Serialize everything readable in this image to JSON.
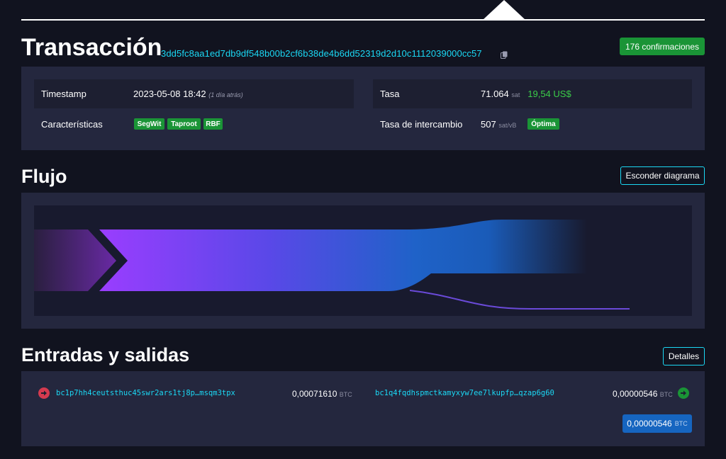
{
  "header": {
    "title": "Transacción",
    "txid": "3dd5fc8aa1ed7db9df548b00b2cf6b38de4b6dd52319d2d10c1112039000cc57",
    "confirmations": "176 confirmaciones"
  },
  "details": {
    "timestamp_label": "Timestamp",
    "timestamp_value": "2023-05-08 18:42",
    "timestamp_ago": "(1 día atrás)",
    "features_label": "Características",
    "features": [
      "SegWit",
      "Taproot",
      "RBF"
    ],
    "fee_label": "Tasa",
    "fee_value": "71.064",
    "fee_unit": "sat",
    "fee_usd": "19,54 US$",
    "fee_rate_label": "Tasa de intercambio",
    "fee_rate_value": "507",
    "fee_rate_unit": "sat/vB",
    "fee_rate_badge": "Óptima"
  },
  "flow": {
    "title": "Flujo",
    "toggle_label": "Esconder diagrama"
  },
  "io": {
    "title": "Entradas y salidas",
    "details_button": "Detalles",
    "input": {
      "address": "bc1p7hh4ceutsthuc45swr2ars1tj8p…msqm3tpx",
      "amount": "0,00071610",
      "unit": "BTC"
    },
    "output": {
      "address": "bc1q4fqdhspmctkamyxyw7ee7lkupfp…qzap6g60",
      "amount": "0,00000546",
      "unit": "BTC"
    },
    "total": {
      "amount": "0,00000546",
      "unit": "BTC"
    }
  },
  "colors": {
    "accent": "#1bd8f4",
    "success": "#1a9436",
    "panel": "#24273e",
    "background": "#11131f",
    "input_icon": "#d43a4f",
    "output_icon": "#1a9436",
    "total_badge": "#1665c0"
  }
}
